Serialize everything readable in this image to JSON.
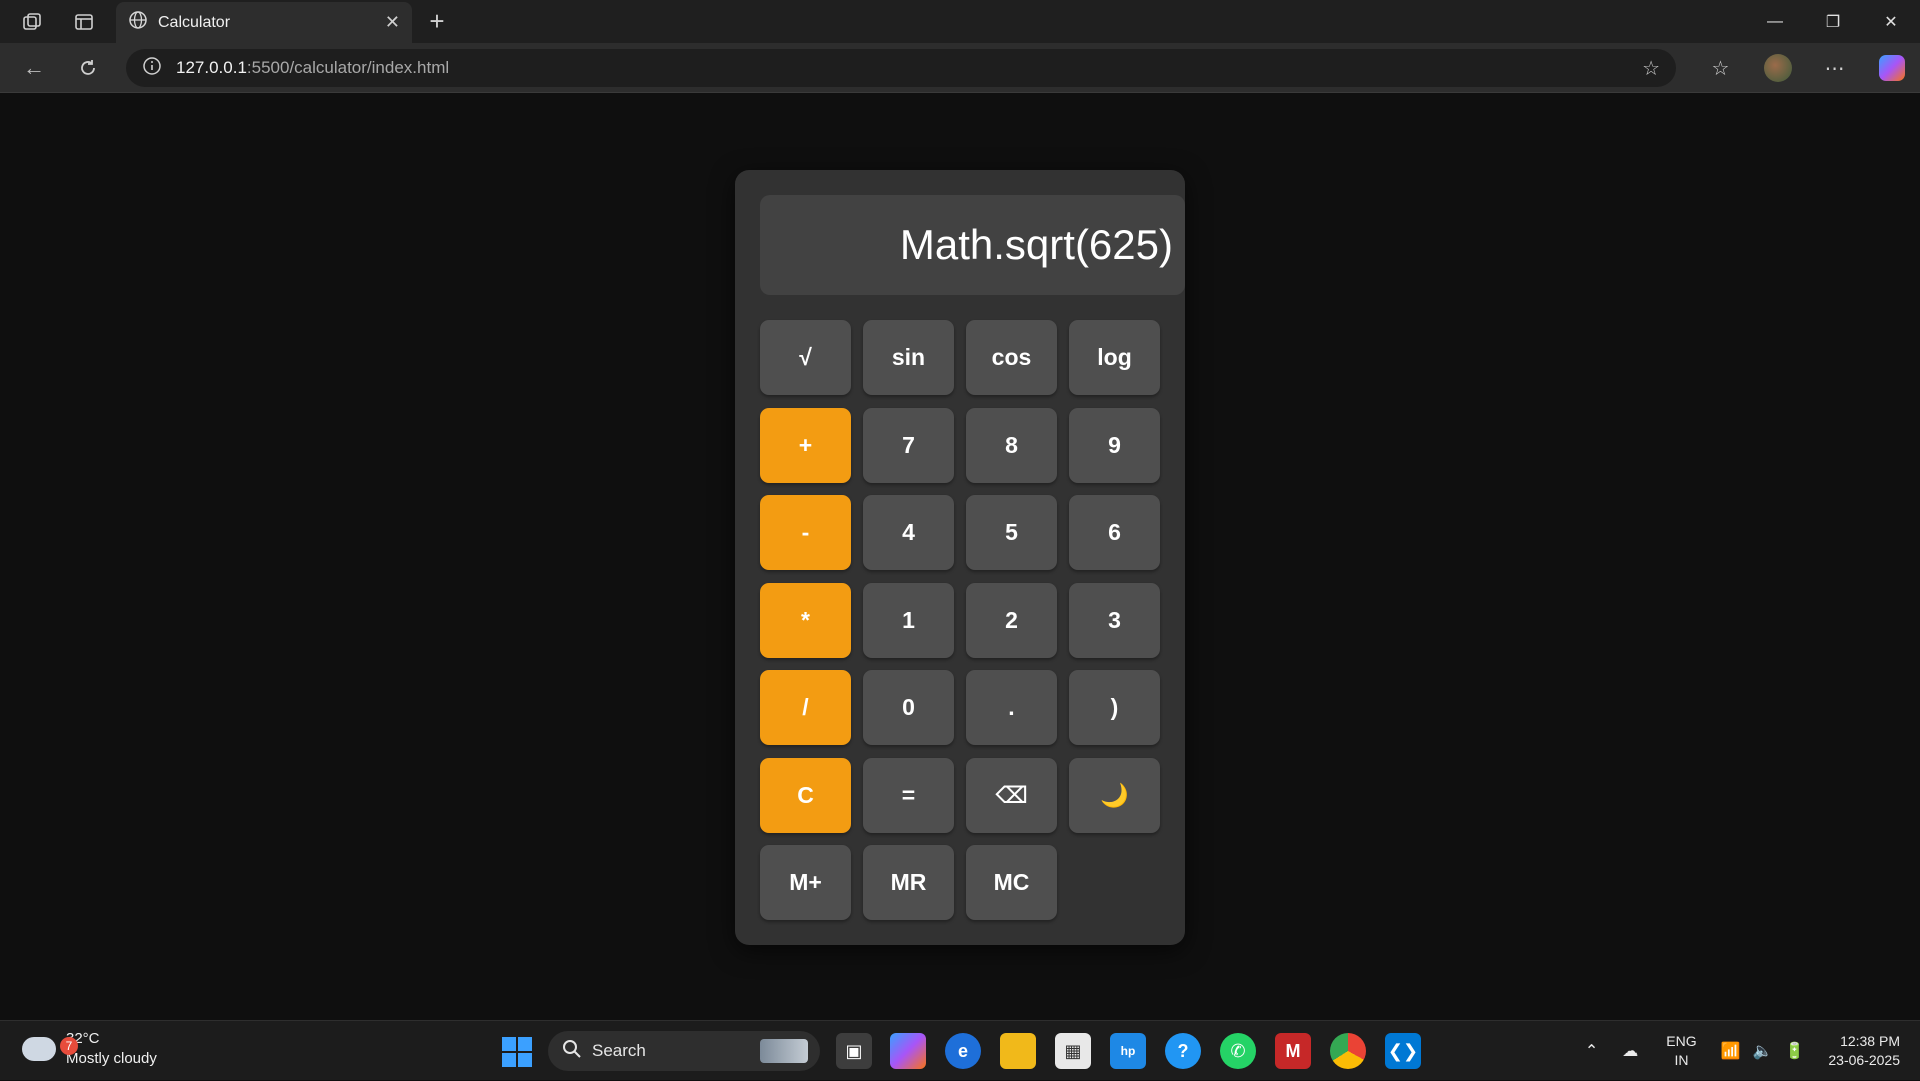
{
  "browser": {
    "tab_title": "Calculator",
    "url_host": "127.0.0.1",
    "url_path": ":5500/calculator/index.html"
  },
  "calculator": {
    "display": "Math.sqrt(625)",
    "rows": [
      [
        {
          "label": "√",
          "type": "fn"
        },
        {
          "label": "sin",
          "type": "fn"
        },
        {
          "label": "cos",
          "type": "fn"
        },
        {
          "label": "log",
          "type": "fn"
        }
      ],
      [
        {
          "label": "+",
          "type": "op"
        },
        {
          "label": "7",
          "type": "num"
        },
        {
          "label": "8",
          "type": "num"
        },
        {
          "label": "9",
          "type": "num"
        }
      ],
      [
        {
          "label": "-",
          "type": "op"
        },
        {
          "label": "4",
          "type": "num"
        },
        {
          "label": "5",
          "type": "num"
        },
        {
          "label": "6",
          "type": "num"
        }
      ],
      [
        {
          "label": "*",
          "type": "op"
        },
        {
          "label": "1",
          "type": "num"
        },
        {
          "label": "2",
          "type": "num"
        },
        {
          "label": "3",
          "type": "num"
        }
      ],
      [
        {
          "label": "/",
          "type": "op"
        },
        {
          "label": "0",
          "type": "num"
        },
        {
          "label": ".",
          "type": "num"
        },
        {
          "label": ")",
          "type": "num"
        }
      ],
      [
        {
          "label": "C",
          "type": "op"
        },
        {
          "label": "=",
          "type": "num"
        },
        {
          "label": "⌫",
          "type": "num"
        },
        {
          "label": "🌙",
          "type": "num"
        }
      ],
      [
        {
          "label": "M+",
          "type": "num"
        },
        {
          "label": "MR",
          "type": "num"
        },
        {
          "label": "MC",
          "type": "num"
        }
      ]
    ]
  },
  "taskbar": {
    "weather_badge": "7",
    "temperature": "32°C",
    "condition": "Mostly cloudy",
    "search_label": "Search",
    "lang_top": "ENG",
    "lang_bottom": "IN",
    "time": "12:38 PM",
    "date": "23-06-2025"
  }
}
